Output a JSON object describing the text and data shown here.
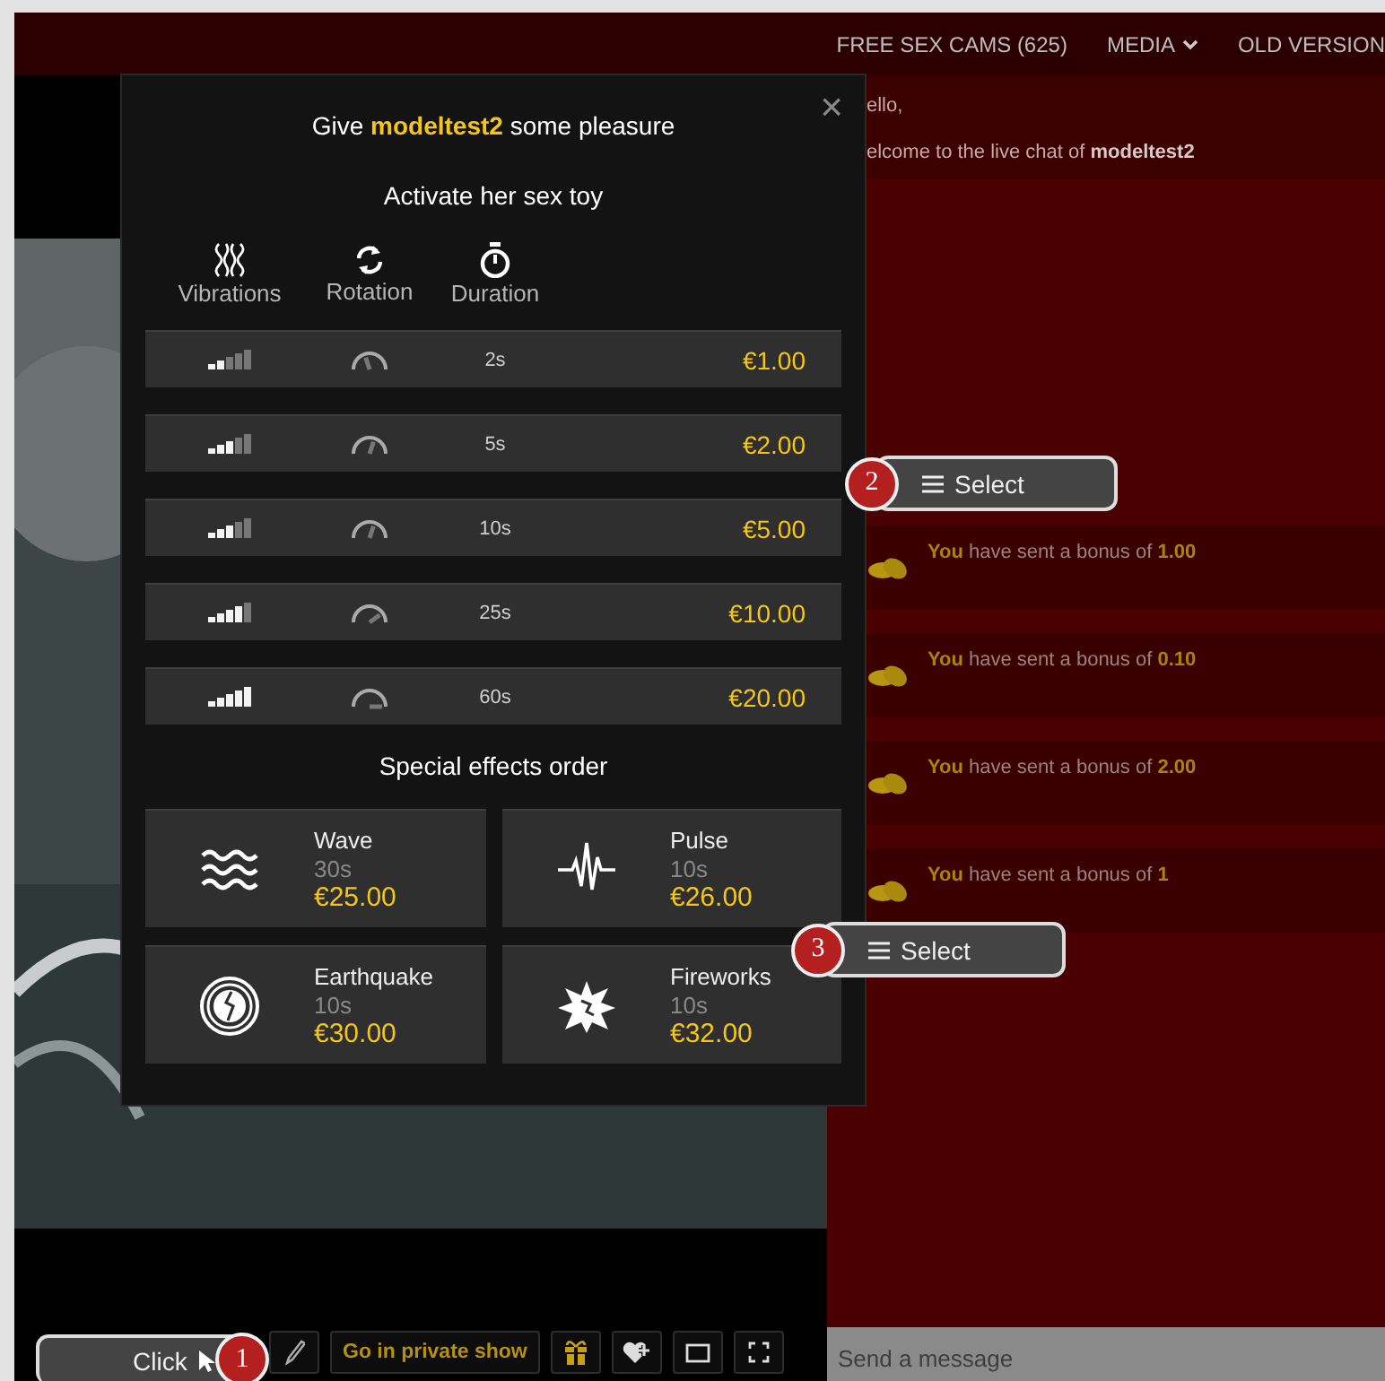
{
  "nav": [
    {
      "label": "FREE SEX CAMS (625)",
      "dropdown": false
    },
    {
      "label": "MEDIA",
      "dropdown": true
    },
    {
      "label": "OLD VERSION",
      "dropdown": false
    }
  ],
  "toolbar": {
    "private_button": "Go in private show"
  },
  "chat": {
    "messages": [
      {
        "kind": "system",
        "text": "ello,"
      },
      {
        "kind": "system",
        "text": "elcome to the live chat of **modeltest2**"
      },
      {
        "kind": "bonus",
        "text": "**You** have sent a bonus of **1.00**"
      },
      {
        "kind": "bonus",
        "text": "**You** have sent a bonus of **0.10**"
      },
      {
        "kind": "bonus",
        "text": "**You** have sent a bonus of **2.00**"
      },
      {
        "kind": "bonus",
        "text": "**You** have sent a bonus of **1**"
      }
    ],
    "input": {
      "placeholder": "Send a message"
    }
  },
  "modal": {
    "title": "Give **modeltest2** some pleasure",
    "close": "×",
    "subtitle": "Activate her sex toy",
    "columns": [
      {
        "kind": "vibrations",
        "label": "Vibrations"
      },
      {
        "kind": "rotation",
        "label": "Rotation"
      },
      {
        "kind": "duration",
        "label": "Duration"
      }
    ],
    "levels": [
      {
        "level": 0.4,
        "duration": "2s",
        "price": "€1.00"
      },
      {
        "level": 0.6,
        "duration": "5s",
        "price": "€2.00"
      },
      {
        "level": 0.6,
        "duration": "10s",
        "price": "€5.00"
      },
      {
        "level": 0.8,
        "duration": "25s",
        "price": "€10.00"
      },
      {
        "level": 1,
        "duration": "60s",
        "price": "€20.00"
      }
    ],
    "effects_title": "Special effects order",
    "effects": [
      {
        "kind": "wave",
        "name": "Wave",
        "duration": "30s",
        "price": "€25.00"
      },
      {
        "kind": "pulse",
        "name": "Pulse",
        "duration": "10s",
        "price": "€26.00"
      },
      {
        "kind": "earthquake",
        "name": "Earthquake",
        "duration": "10s",
        "price": "€30.00"
      },
      {
        "kind": "fireworks",
        "name": "Fireworks",
        "duration": "10s",
        "price": "€32.00"
      }
    ]
  },
  "callouts": [
    {
      "number": "1",
      "label": "Click"
    },
    {
      "number": "2",
      "label": "Select"
    },
    {
      "number": "3",
      "label": "Select"
    }
  ]
}
